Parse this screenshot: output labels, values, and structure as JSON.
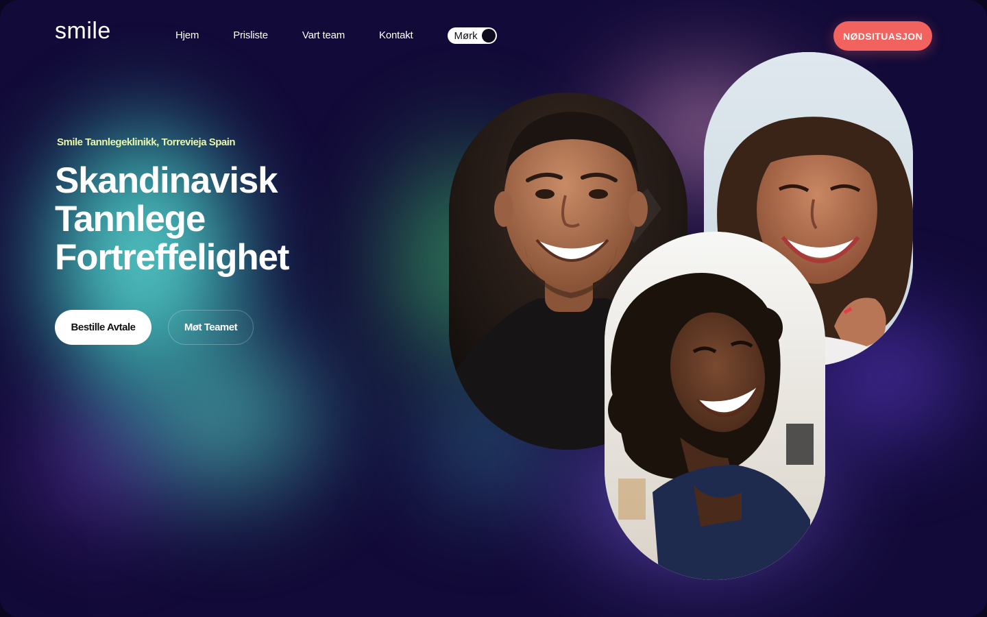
{
  "brand": {
    "logo_text": "smile"
  },
  "nav": {
    "items": [
      {
        "label": "Hjem"
      },
      {
        "label": "Prisliste"
      },
      {
        "label": "Vart team"
      },
      {
        "label": "Kontakt"
      }
    ],
    "theme_toggle": {
      "label": "Mørk",
      "state": "dark"
    }
  },
  "header": {
    "emergency_label": "NØDSITUASJON"
  },
  "hero": {
    "eyebrow": "Smile Tannlegeklinikk, Torrevieja Spain",
    "headline_lines": [
      "Skandinavisk",
      "Tannlege",
      "Fortreffelighet"
    ],
    "primary_cta": "Bestille Avtale",
    "secondary_cta": "Møt Teamet"
  },
  "colors": {
    "accent_emergency": "#f2625f",
    "eyebrow": "#e9f7a8",
    "background": "#120a38"
  }
}
